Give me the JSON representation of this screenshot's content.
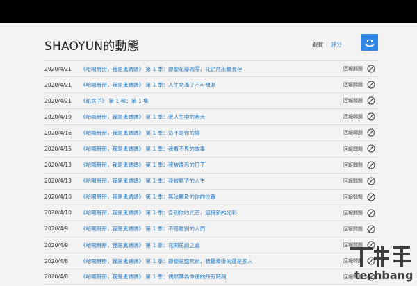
{
  "header": {
    "title": "SHAOYUN的動態",
    "viewing_label": "觀賞",
    "ratings_label": "評分"
  },
  "accent_color": "#2f86e6",
  "link_color": "#2277c4",
  "rows": [
    {
      "date": "2020/4/21",
      "title": "《哈囉掰掰，我是鬼媽媽》 第 1 季：即便花瓣凋零，花仍然永續長存",
      "report": "回報問題"
    },
    {
      "date": "2020/4/21",
      "title": "《哈囉掰掰，我是鬼媽媽》 第 1 季：人生充滿了不可預測",
      "report": "回報問題"
    },
    {
      "date": "2020/4/21",
      "title": "《紙房子》 第 1 部：第 1 集",
      "report": "回報問題"
    },
    {
      "date": "2020/4/19",
      "title": "《哈囉掰掰，我是鬼媽媽》 第 1 季：我人生中的明天",
      "report": "回報問題"
    },
    {
      "date": "2020/4/16",
      "title": "《哈囉掰掰，我是鬼媽媽》 第 1 季：這不是你的錯",
      "report": "回報問題"
    },
    {
      "date": "2020/4/15",
      "title": "《哈囉掰掰，我是鬼媽媽》 第 1 季：我看不見的故事",
      "report": "回報問題"
    },
    {
      "date": "2020/4/13",
      "title": "《哈囉掰掰，我是鬼媽媽》 第 1 季：我被遺忘的日子",
      "report": "回報問題"
    },
    {
      "date": "2020/4/13",
      "title": "《哈囉掰掰，我是鬼媽媽》 第 1 季：我被賦予的人生",
      "report": "回報問題"
    },
    {
      "date": "2020/4/10",
      "title": "《哈囉掰掰，我是鬼媽媽》 第 1 季：無法觸及的你的位置",
      "report": "回報問題"
    },
    {
      "date": "2020/4/10",
      "title": "《哈囉掰掰，我是鬼媽媽》 第 1 季：告別你的光芒，迎接新的光彩",
      "report": "回報問題"
    },
    {
      "date": "2020/4/9",
      "title": "《哈囉掰掰，我是鬼媽媽》 第 1 季：不搭離別的人們",
      "report": "回報問題"
    },
    {
      "date": "2020/4/9",
      "title": "《哈囉掰掰，我是鬼媽媽》 第 1 季：花開花謝之處",
      "report": "回報問題"
    },
    {
      "date": "2020/4/8",
      "title": "《哈囉掰掰，我是鬼媽媽》 第 1 季：即便是臨死前，我最牽掛的還是家人",
      "report": "回報問題"
    },
    {
      "date": "2020/4/8",
      "title": "《哈囉掰掰，我是鬼媽媽》 第 1 季：偶然轉為命運的所有時刻",
      "report": "回報問題"
    }
  ],
  "watermark": {
    "brand_text": "techbang"
  }
}
